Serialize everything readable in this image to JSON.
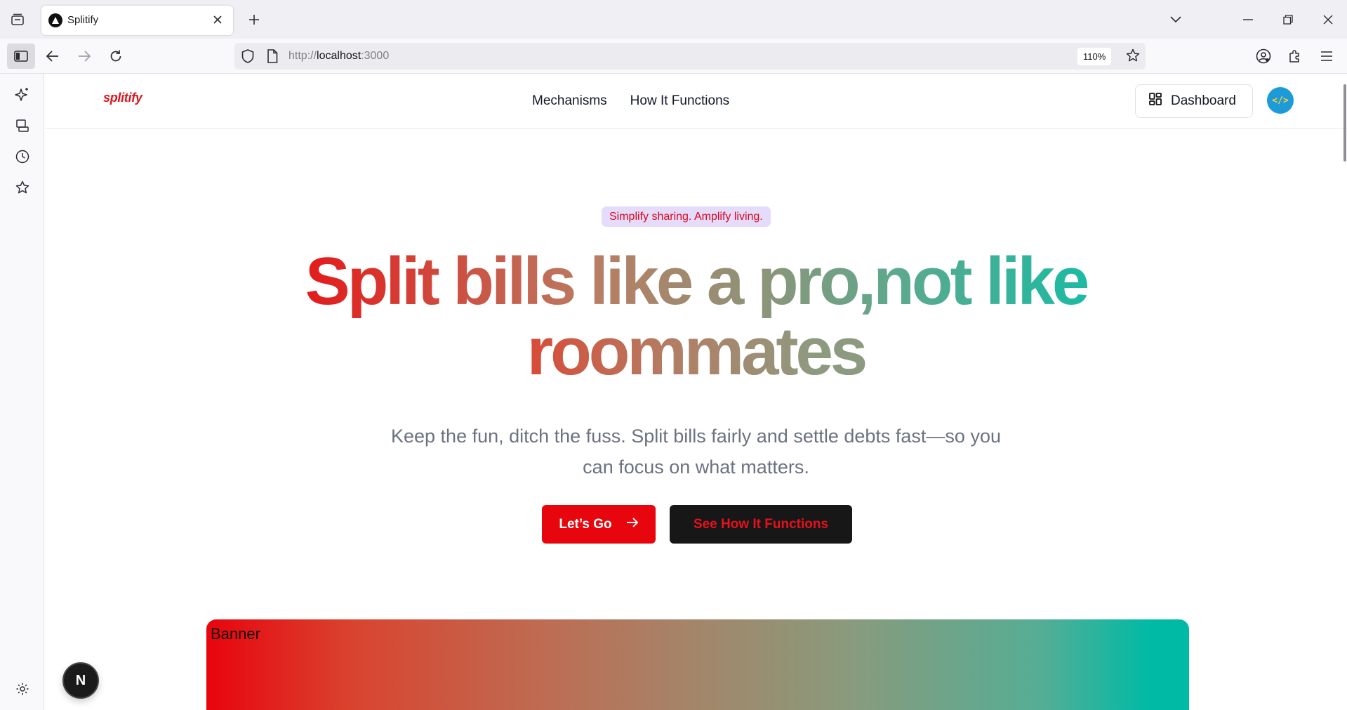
{
  "browser": {
    "tab_title": "Splitify",
    "url_prefix": "http://",
    "url_host": "localhost",
    "url_port": ":3000",
    "zoom": "110%"
  },
  "site": {
    "logo": "splitify",
    "nav": [
      "Mechanisms",
      "How It Functions"
    ],
    "dashboard_label": "Dashboard",
    "avatar_text": "</>"
  },
  "hero": {
    "tagline": "Simplify sharing. Amplify living.",
    "title_line1": "Split bills like a pro,not like",
    "title_line2": "roommates",
    "subtitle_line1": "Keep the fun, ditch the fuss. Split bills fairly and settle debts fast—so you",
    "subtitle_line2": "can focus on what matters.",
    "primary_cta": "Let’s Go",
    "secondary_cta": "See How It Functions"
  },
  "banner": {
    "label": "Banner"
  },
  "devtools": {
    "badge": "N"
  },
  "colors": {
    "brand_red": "#e8060e",
    "brand_teal": "#00baa6",
    "tagline_bg": "#e5dcfb",
    "secondary_btn_bg": "#171717"
  }
}
